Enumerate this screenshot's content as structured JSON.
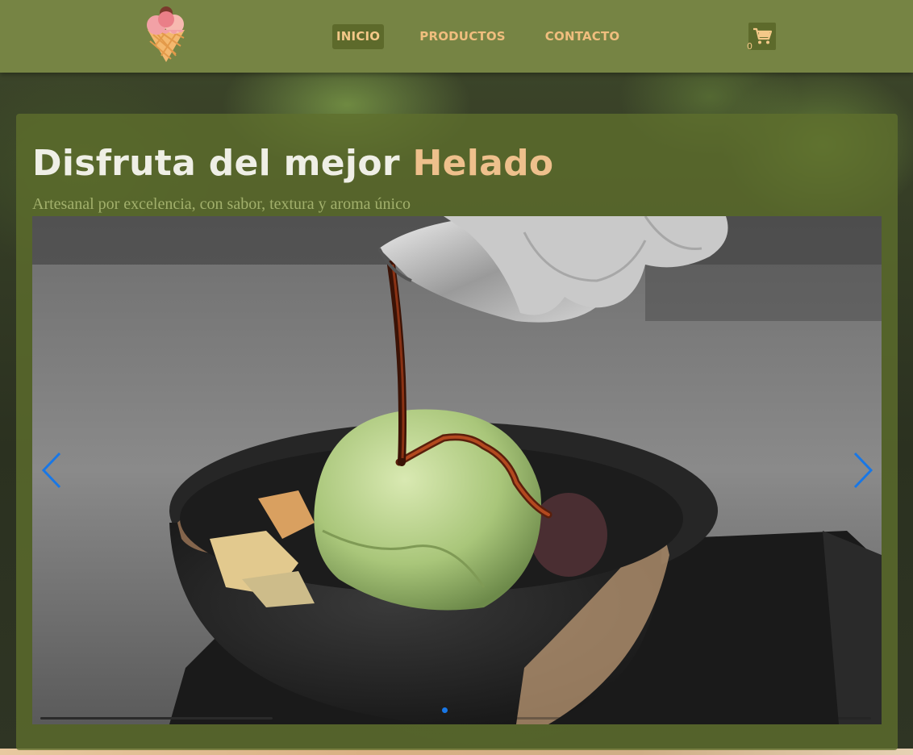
{
  "header": {
    "nav": [
      {
        "label": "INICIO",
        "active": true
      },
      {
        "label": "PRODUCTOS",
        "active": false
      },
      {
        "label": "CONTACTO",
        "active": false
      }
    ],
    "cart_count": "0",
    "cart_icon": "shopping-cart-icon",
    "logo_icon": "ice-cream-cone-icon"
  },
  "hero": {
    "title_main": "Disfruta del mejor ",
    "title_accent": "Helado",
    "subtitle": "Artesanal por excelencia, con sabor, textura y aroma único"
  },
  "carousel": {
    "slide_image": "ice-cream-bowl-photo",
    "prev_icon": "chevron-left-icon",
    "next_icon": "chevron-right-icon",
    "progress": 0.28,
    "slide_count": 1,
    "current_slide": 1
  },
  "colors": {
    "header_bg": "#768444",
    "nav_text": "#f0be7e",
    "accent": "#eec08c",
    "arrow": "#1877e6"
  }
}
